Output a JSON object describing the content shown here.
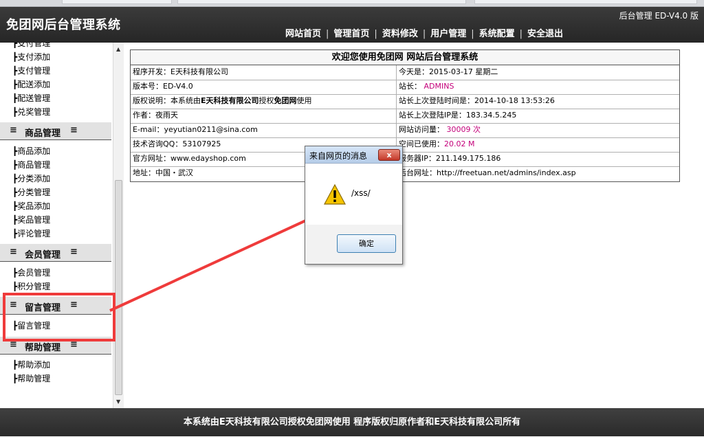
{
  "header": {
    "site_title": "免团网后台管理系统",
    "version_text": "后台管理 ED-V4.0 版",
    "nav": [
      "网站首页",
      "管理首页",
      "资料修改",
      "用户管理",
      "系统配置",
      "安全退出"
    ],
    "nav_separator": "|"
  },
  "sidebar": {
    "partial_link": "┣支付管理",
    "group1_links": [
      "┣支付添加",
      "┣支付管理",
      "┣配送添加",
      "┣配送管理",
      "┣兑奖管理"
    ],
    "product_header": "商品管理",
    "product_links": [
      "┣商品添加",
      "┣商品管理",
      "┣分类添加",
      "┣分类管理",
      "┣奖品添加",
      "┣奖品管理",
      "┣评论管理"
    ],
    "member_header": "会员管理",
    "member_links": [
      "┣会员管理",
      "┣积分管理"
    ],
    "message_header": "留言管理",
    "message_links": [
      "┣留言管理"
    ],
    "help_header": "帮助管理",
    "help_links": [
      "┣帮助添加",
      "┣帮助管理"
    ],
    "header_mark": "≡"
  },
  "info": {
    "caption": "欢迎您使用免团网 网站后台管理系统",
    "left": [
      {
        "label": "程序开发：",
        "value": "E天科技有限公司"
      },
      {
        "label": "版本号：",
        "value": "ED-V4.0"
      },
      {
        "label": "版权说明：本系统由",
        "value": "E天科技有限公司",
        "mid": "授权",
        "value2": "免团网",
        "tail": "使用"
      },
      {
        "label": "作者：",
        "value": "夜雨天"
      },
      {
        "label": "E-mail：",
        "value": "yeyutian0211@sina.com"
      },
      {
        "label": "技术咨询QQ：",
        "value": "53107925"
      },
      {
        "label": "官方网址：",
        "value": "www.edayshop.com"
      },
      {
        "label": "地址：",
        "value": "中国・武汉"
      }
    ],
    "right": [
      {
        "label": "今天是：",
        "value": "2015-03-17 星期二"
      },
      {
        "label": "站长：",
        "value": "ADMINS"
      },
      {
        "label": "站长上次登陆时间是：",
        "value": "2014-10-18 13:53:26"
      },
      {
        "label": "站长上次登陆IP是：",
        "value": "183.34.5.245"
      },
      {
        "label": "网站访问量：",
        "value": "30009 次"
      },
      {
        "label": "空间已使用：",
        "value": "20.02 M"
      },
      {
        "label": "服务器IP：",
        "value": "211.149.175.186"
      },
      {
        "label": "后台网址：",
        "value": "http://freetuan.net/admins/index.asp"
      }
    ]
  },
  "dialog": {
    "title": "来自网页的消息",
    "close_label": "x",
    "message": "/xss/",
    "ok_label": "确定"
  },
  "footer": {
    "text": "本系统由E天科技有限公司授权免团网使用 程序版权归原作者和E天科技有限公司所有"
  },
  "colors": {
    "header_bg": "#2e2e2e",
    "highlight": "#c4007a",
    "annotation_red": "#ef3b3b"
  },
  "icons": {
    "dialog_icon": "warning-icon",
    "close_icon": "close-icon"
  }
}
